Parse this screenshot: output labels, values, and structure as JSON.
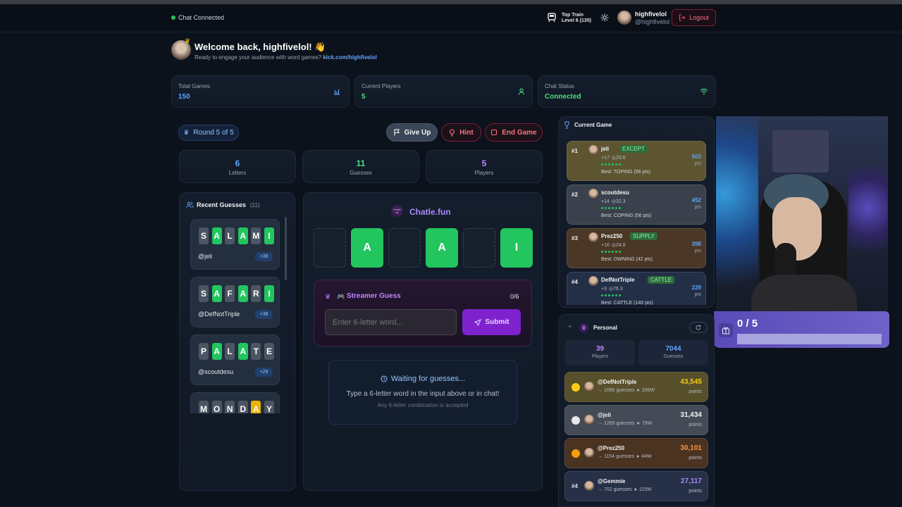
{
  "topbar": {
    "chat_status": "Chat Connected",
    "train_title": "Top Train",
    "train_level": "Level 6",
    "train_count": "(135)",
    "username": "highfivelol",
    "handle": "@highfivelol",
    "logout_label": "Logout"
  },
  "welcome": {
    "title": "Welcome back, highfivelol!",
    "emoji": "👋",
    "subtitle": "Ready to engage your audience with word games?",
    "link": "kick.com/highfivelol"
  },
  "stats": [
    {
      "label": "Total Games",
      "value": "150",
      "icon": "bar-chart-icon"
    },
    {
      "label": "Current Players",
      "value": "5",
      "icon": "user-icon"
    },
    {
      "label": "Chat Status",
      "value": "Connected",
      "icon": "wifi-icon"
    }
  ],
  "game": {
    "round": "Round 5 of 5",
    "give_up": "Give Up",
    "hint": "Hint",
    "end_game": "End Game",
    "counters": [
      {
        "value": "6",
        "label": "Letters",
        "color": "#60a5fa"
      },
      {
        "value": "11",
        "label": "Guesses",
        "color": "#4ade80"
      },
      {
        "value": "5",
        "label": "Players",
        "color": "#c084fc"
      }
    ],
    "brand": "Chatle.fun",
    "logo_text": "Chatle fun",
    "board": [
      "",
      "A",
      "",
      "A",
      "",
      "I"
    ],
    "streamer_guess_title": "Streamer Guess",
    "streamer_guess_count": "0/6",
    "input_placeholder": "Enter 6-letter word...",
    "submit_label": "Submit",
    "waiting_title": "Waiting for guesses...",
    "waiting_line1": "Type a 6-letter word in the input above or in chat!",
    "waiting_line2": "Any 6-letter combination is accepted"
  },
  "recent": {
    "title": "Recent Guesses",
    "count": "(11)",
    "items": [
      {
        "letters": [
          "S",
          "A",
          "L",
          "A",
          "M",
          "I"
        ],
        "states": [
          "x",
          "h",
          "x",
          "h",
          "x",
          "h"
        ],
        "user": "@jeli",
        "points": "+38"
      },
      {
        "letters": [
          "S",
          "A",
          "F",
          "A",
          "R",
          "I"
        ],
        "states": [
          "x",
          "h",
          "x",
          "h",
          "x",
          "h"
        ],
        "user": "@DefNotTriple",
        "points": "+38"
      },
      {
        "letters": [
          "P",
          "A",
          "L",
          "A",
          "T",
          "E"
        ],
        "states": [
          "x",
          "h",
          "x",
          "h",
          "x",
          "x"
        ],
        "user": "@scoutdesu",
        "points": "+29"
      },
      {
        "letters": [
          "M",
          "O",
          "N",
          "D",
          "A",
          "Y"
        ],
        "states": [
          "x",
          "x",
          "x",
          "x",
          "n",
          "x"
        ],
        "user": "",
        "points": ""
      }
    ]
  },
  "current_game": {
    "title": "Current Game",
    "players": [
      {
        "rank": "#1",
        "name": "jeli",
        "tag": "EXCEPT",
        "plus": "17",
        "avg": "29.6",
        "best": "Best: TOPING (56 pts)",
        "pts": "503",
        "pts_label": "pts",
        "bg": "#5c5530",
        "tagbg": "#2f6b3a",
        "tagfg": "#86efac"
      },
      {
        "rank": "#2",
        "name": "scoutdesu",
        "tag": "",
        "plus": "14",
        "avg": "32.3",
        "best": "Best: COPING (56 pts)",
        "pts": "452",
        "pts_label": "pts",
        "bg": "#3a414c",
        "tagbg": "",
        "tagfg": ""
      },
      {
        "rank": "#3",
        "name": "Prez250",
        "tag": "SUPPLY",
        "plus": "16",
        "avg": "24.8",
        "best": "Best: OWNING (42 pts)",
        "pts": "398",
        "pts_label": "pts",
        "bg": "#4a3726",
        "tagbg": "#2f6b3a",
        "tagfg": "#86efac"
      },
      {
        "rank": "#4",
        "name": "DefNotTriple",
        "tag": "CATTLE",
        "plus": "3",
        "avg": "76.3",
        "best": "Best: CATTLE (140 pts)",
        "pts": "229",
        "pts_label": "pts",
        "bg": "#232e47",
        "tagbg": "#2f6b3a",
        "tagfg": "#86efac"
      }
    ]
  },
  "personal": {
    "title": "Personal",
    "players_value": "39",
    "players_label": "Players",
    "guesses_value": "7044",
    "guesses_label": "Guesses",
    "rows": [
      {
        "rank": "",
        "name": "@DefNotTriple",
        "guesses": "1096 guesses",
        "wins": "206W",
        "points": "43,545",
        "points_label": "points",
        "bg": "#57502a",
        "medal": "#facc15",
        "pcolor": "#facc15"
      },
      {
        "rank": "",
        "name": "@jeli",
        "guesses": "1269 guesses",
        "wins": "79W",
        "points": "31,434",
        "points_label": "points",
        "bg": "#444b56",
        "medal": "#e5e7eb",
        "pcolor": "#f3f4f6"
      },
      {
        "rank": "",
        "name": "@Prez250",
        "guesses": "1154 guesses",
        "wins": "44W",
        "points": "30,101",
        "points_label": "points",
        "bg": "#4b3322",
        "medal": "#f59e0b",
        "pcolor": "#fb923c"
      },
      {
        "rank": "#4",
        "name": "@Gemmie",
        "guesses": "702 guesses",
        "wins": "115W",
        "points": "27,117",
        "points_label": "points",
        "bg": "#263047",
        "medal": "",
        "pcolor": "#a78bfa"
      }
    ]
  },
  "overlay": {
    "progress_text": "0 / 5",
    "progress_fraction": 0
  }
}
